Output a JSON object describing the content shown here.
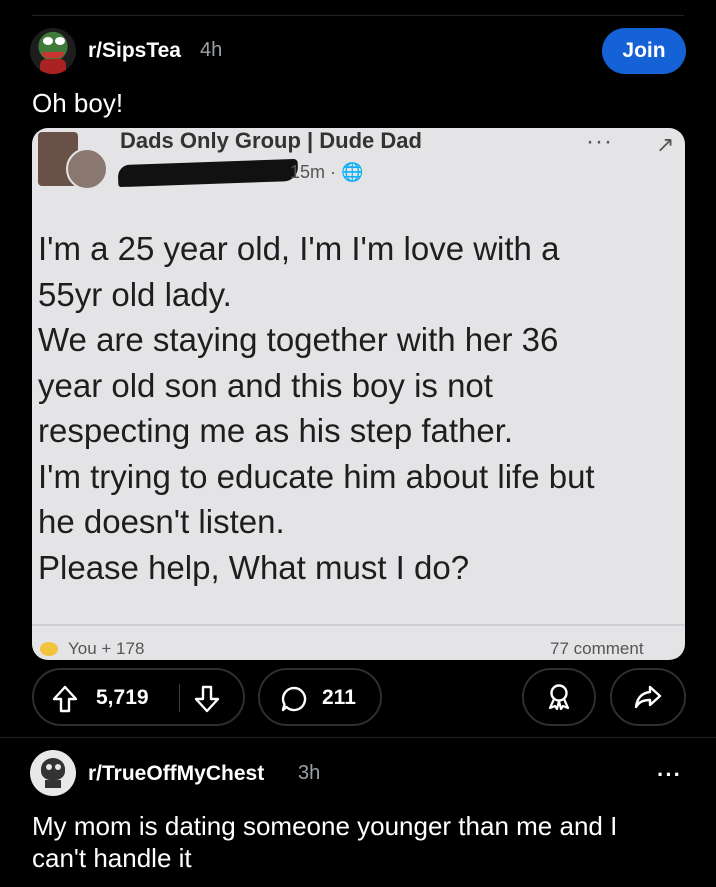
{
  "post": {
    "subreddit": "r/SipsTea",
    "age": "4h",
    "join_label": "Join",
    "title": "Oh boy!",
    "image": {
      "group_name": "Dads Only Group | Dude Dad",
      "post_meta": "15m · 🌐",
      "more_label": "···",
      "close_label": "↗",
      "body_text": "I'm a 25 year old, I'm I'm love with a\n55yr old lady.\nWe are staying together with her 36\nyear old son and this boy is not\nrespecting me as his step father.\nI'm trying to educate him about life but\nhe doesn't listen.\nPlease help, What must I do?",
      "reactions": "You + 178",
      "comments": "77 comment"
    },
    "upvotes": "5,719",
    "comment_count": "211"
  },
  "next_post": {
    "subreddit": "r/TrueOffMyChest",
    "age": "3h",
    "more_label": "···",
    "title": "My mom is dating someone younger than me and I can't handle it"
  },
  "icons": {
    "upvote": "arrow-up-icon",
    "downvote": "arrow-down-icon",
    "comment": "comment-bubble-icon",
    "award": "award-icon",
    "share": "share-icon",
    "more": "more-icon"
  },
  "colors": {
    "background": "#000000",
    "join_button": "#1561d6",
    "muted_text": "#9aa1a6"
  }
}
